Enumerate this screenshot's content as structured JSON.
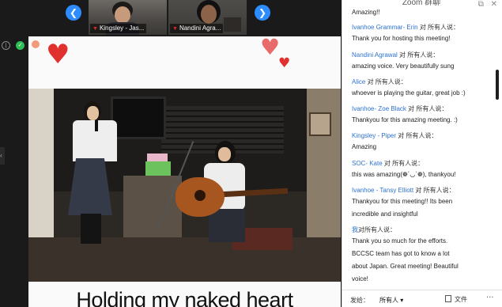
{
  "gallery": {
    "prev_icon": "chevron-left-icon",
    "next_icon": "chevron-right-icon",
    "participants": [
      {
        "name": "Kingsley - Jas...",
        "muted": true
      },
      {
        "name": "Nandini Agra...",
        "muted": true
      }
    ]
  },
  "slide": {
    "caption": "Holding my naked heart",
    "heart_color": "#e0312f"
  },
  "chat": {
    "title": "Zoom 群聊",
    "messages": [
      {
        "sender": "",
        "to": "",
        "lines": [
          "Amazing!!"
        ]
      },
      {
        "sender": "Ivanhoe Grammar- Erin",
        "to": "对 所有人说：",
        "lines": [
          "Thank you for hosting this meeting!"
        ]
      },
      {
        "sender": "Nandini Agrawal",
        "to": "对 所有人说：",
        "lines": [
          "amazing voice. Very beautifully sung"
        ]
      },
      {
        "sender": "Alice",
        "to": "对 所有人说：",
        "lines": [
          "whoever is playing the guitar, great job :)"
        ]
      },
      {
        "sender": "Ivanhoe- Zoe Black",
        "to": "对 所有人说：",
        "lines": [
          "Thankyou for this amazing meeting. :)"
        ]
      },
      {
        "sender": "Kingsley - Piper",
        "to": "对 所有人说：",
        "lines": [
          "Amazing"
        ]
      },
      {
        "sender": "SOC- Kate",
        "to": "对 所有人说：",
        "lines": [
          "this was amazing(❁´◡`❁), thankyou!"
        ]
      },
      {
        "sender": "Ivanhoe - Tansy Elliott",
        "to": "对 所有人说：",
        "lines": [
          "Thankyou for this meeting!! Its been",
          "incredible and insightful"
        ]
      },
      {
        "sender": "我",
        "to": "对所有人说：",
        "lines": [
          "Thank you so much for the efforts.",
          "BCCSC team has got to know a lot",
          "about Japan. Great meeting! Beautiful",
          "voice!"
        ]
      }
    ],
    "send_label": "发给：",
    "send_target": "所有人 ▾",
    "file_label": "文件",
    "more_label": "···",
    "accent_color": "#2d72d2"
  }
}
